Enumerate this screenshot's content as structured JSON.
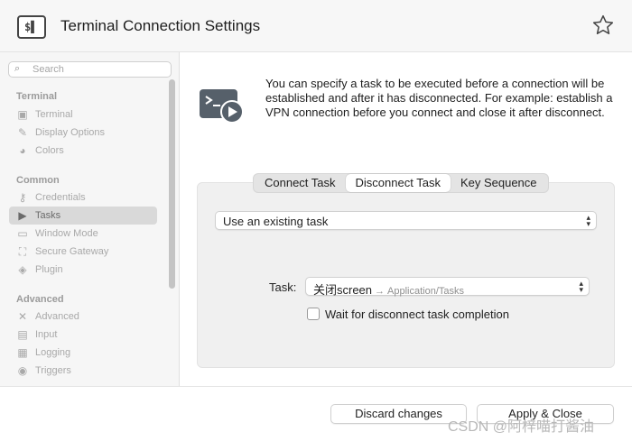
{
  "window": {
    "title": "Terminal Connection Settings",
    "app_icon": "terminal-icon",
    "star_icon": "star-icon"
  },
  "sidebar": {
    "search_placeholder": "Search",
    "sections": [
      {
        "title": "Terminal",
        "items": [
          {
            "label": "Terminal",
            "icon": "terminal-icon"
          },
          {
            "label": "Display Options",
            "icon": "brush-icon"
          },
          {
            "label": "Colors",
            "icon": "palette-icon"
          }
        ]
      },
      {
        "title": "Common",
        "items": [
          {
            "label": "Credentials",
            "icon": "key-icon"
          },
          {
            "label": "Tasks",
            "icon": "tasks-icon",
            "active": true
          },
          {
            "label": "Window Mode",
            "icon": "window-icon"
          },
          {
            "label": "Secure Gateway",
            "icon": "gateway-icon"
          },
          {
            "label": "Plugin",
            "icon": "plugin-icon"
          }
        ]
      },
      {
        "title": "Advanced",
        "items": [
          {
            "label": "Advanced",
            "icon": "tools-icon"
          },
          {
            "label": "Input",
            "icon": "keyboard-icon"
          },
          {
            "label": "Logging",
            "icon": "document-icon"
          },
          {
            "label": "Triggers",
            "icon": "trigger-icon"
          }
        ]
      }
    ]
  },
  "main": {
    "description": "You can specify a task to be executed before a connection will be established and after it has disconnected. For example: establish a VPN connection before you connect and close it after disconnect.",
    "tabs": [
      {
        "label": "Connect Task",
        "selected": false
      },
      {
        "label": "Disconnect Task",
        "selected": true
      },
      {
        "label": "Key Sequence",
        "selected": false
      }
    ],
    "mode_select": {
      "value": "Use an existing task"
    },
    "task": {
      "label": "Task:",
      "value": "关闭screen",
      "arrow": "→",
      "path": "Application/Tasks"
    },
    "wait_checkbox": {
      "label": "Wait for disconnect task completion",
      "checked": false
    }
  },
  "footer": {
    "discard_label": "Discard changes",
    "apply_label": "Apply & Close",
    "watermark": "CSDN @阿梓喵打酱油"
  },
  "colors": {
    "active_item_bg": "#d9d9d9",
    "panel_bg": "#f0f0f0",
    "header_bg": "#f7f7f7"
  }
}
